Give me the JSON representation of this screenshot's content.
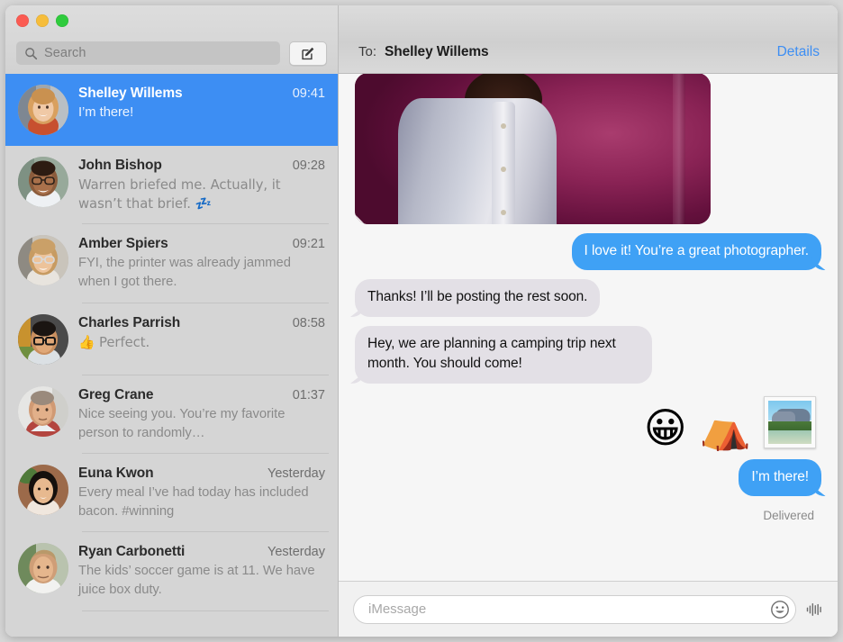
{
  "window": {
    "traffic_lights": [
      {
        "name": "close",
        "color": "#fb5b52"
      },
      {
        "name": "minimize",
        "color": "#f6bd3b"
      },
      {
        "name": "zoom",
        "color": "#2fcb3d"
      }
    ]
  },
  "sidebar": {
    "search": {
      "placeholder": "Search",
      "icon": "search-icon"
    },
    "compose": {
      "icon": "compose-pencil-icon",
      "label": "New Message"
    },
    "conversations": [
      {
        "name": "Shelley Willems",
        "time": "09:41",
        "preview": "I’m there!",
        "selected": true,
        "avatar": "woman-blonde-portrait"
      },
      {
        "name": "John Bishop",
        "time": "09:28",
        "preview": "Warren briefed me. Actually, it wasn’t that brief. 💤",
        "selected": false,
        "avatar": "man-glasses-portrait"
      },
      {
        "name": "Amber Spiers",
        "time": "09:21",
        "preview": "FYI, the printer was already jammed when I got there.",
        "selected": false,
        "avatar": "woman-glasses-portrait"
      },
      {
        "name": "Charles Parrish",
        "time": "08:58",
        "preview": "👍 Perfect.",
        "selected": false,
        "avatar": "man-dark-glasses-portrait"
      },
      {
        "name": "Greg Crane",
        "time": "01:37",
        "preview": "Nice seeing you. You’re my favorite person to randomly…",
        "selected": false,
        "avatar": "older-man-portrait"
      },
      {
        "name": "Euna Kwon",
        "time": "Yesterday",
        "preview": "Every meal I’ve had today has included bacon. #winning",
        "selected": false,
        "avatar": "woman-dark-hair-portrait"
      },
      {
        "name": "Ryan Carbonetti",
        "time": "Yesterday",
        "preview": "The kids’ soccer game is at 11. We have juice box duty.",
        "selected": false,
        "avatar": "man-blond-portrait"
      }
    ]
  },
  "conversation": {
    "to_label": "To:",
    "recipient": "Shelley Willems",
    "details_label": "Details",
    "messages": [
      {
        "type": "photo",
        "direction": "in",
        "alt": "Photo of person in light shirt against magenta wall"
      },
      {
        "type": "text",
        "direction": "out",
        "text": "I love it! You’re a great photographer."
      },
      {
        "type": "text",
        "direction": "in",
        "text": "Thanks! I’ll be posting the rest soon."
      },
      {
        "type": "text",
        "direction": "in",
        "text": "Hey, we are planning a camping trip next month. You should come!"
      }
    ],
    "stickers": [
      {
        "name": "grinning-face-emoji",
        "glyph": "😀"
      },
      {
        "name": "camping-tent-emoji",
        "glyph": "⛺"
      },
      {
        "name": "landscape-photo-sticker",
        "glyph": ""
      }
    ],
    "last_message": {
      "direction": "out",
      "text": "I’m there!"
    },
    "status": "Delivered"
  },
  "composer": {
    "placeholder": "iMessage",
    "emoji_button": "emoji-smiley-icon",
    "audio_button": "audio-waveform-icon"
  },
  "colors": {
    "accent_blue": "#3d8ef3",
    "bubble_out": "#3fa1f5",
    "bubble_in": "#e3e0e6",
    "sidebar_bg": "#d5d5d5",
    "thread_bg": "#f6f6f6",
    "link_blue": "#3d8ef3"
  }
}
